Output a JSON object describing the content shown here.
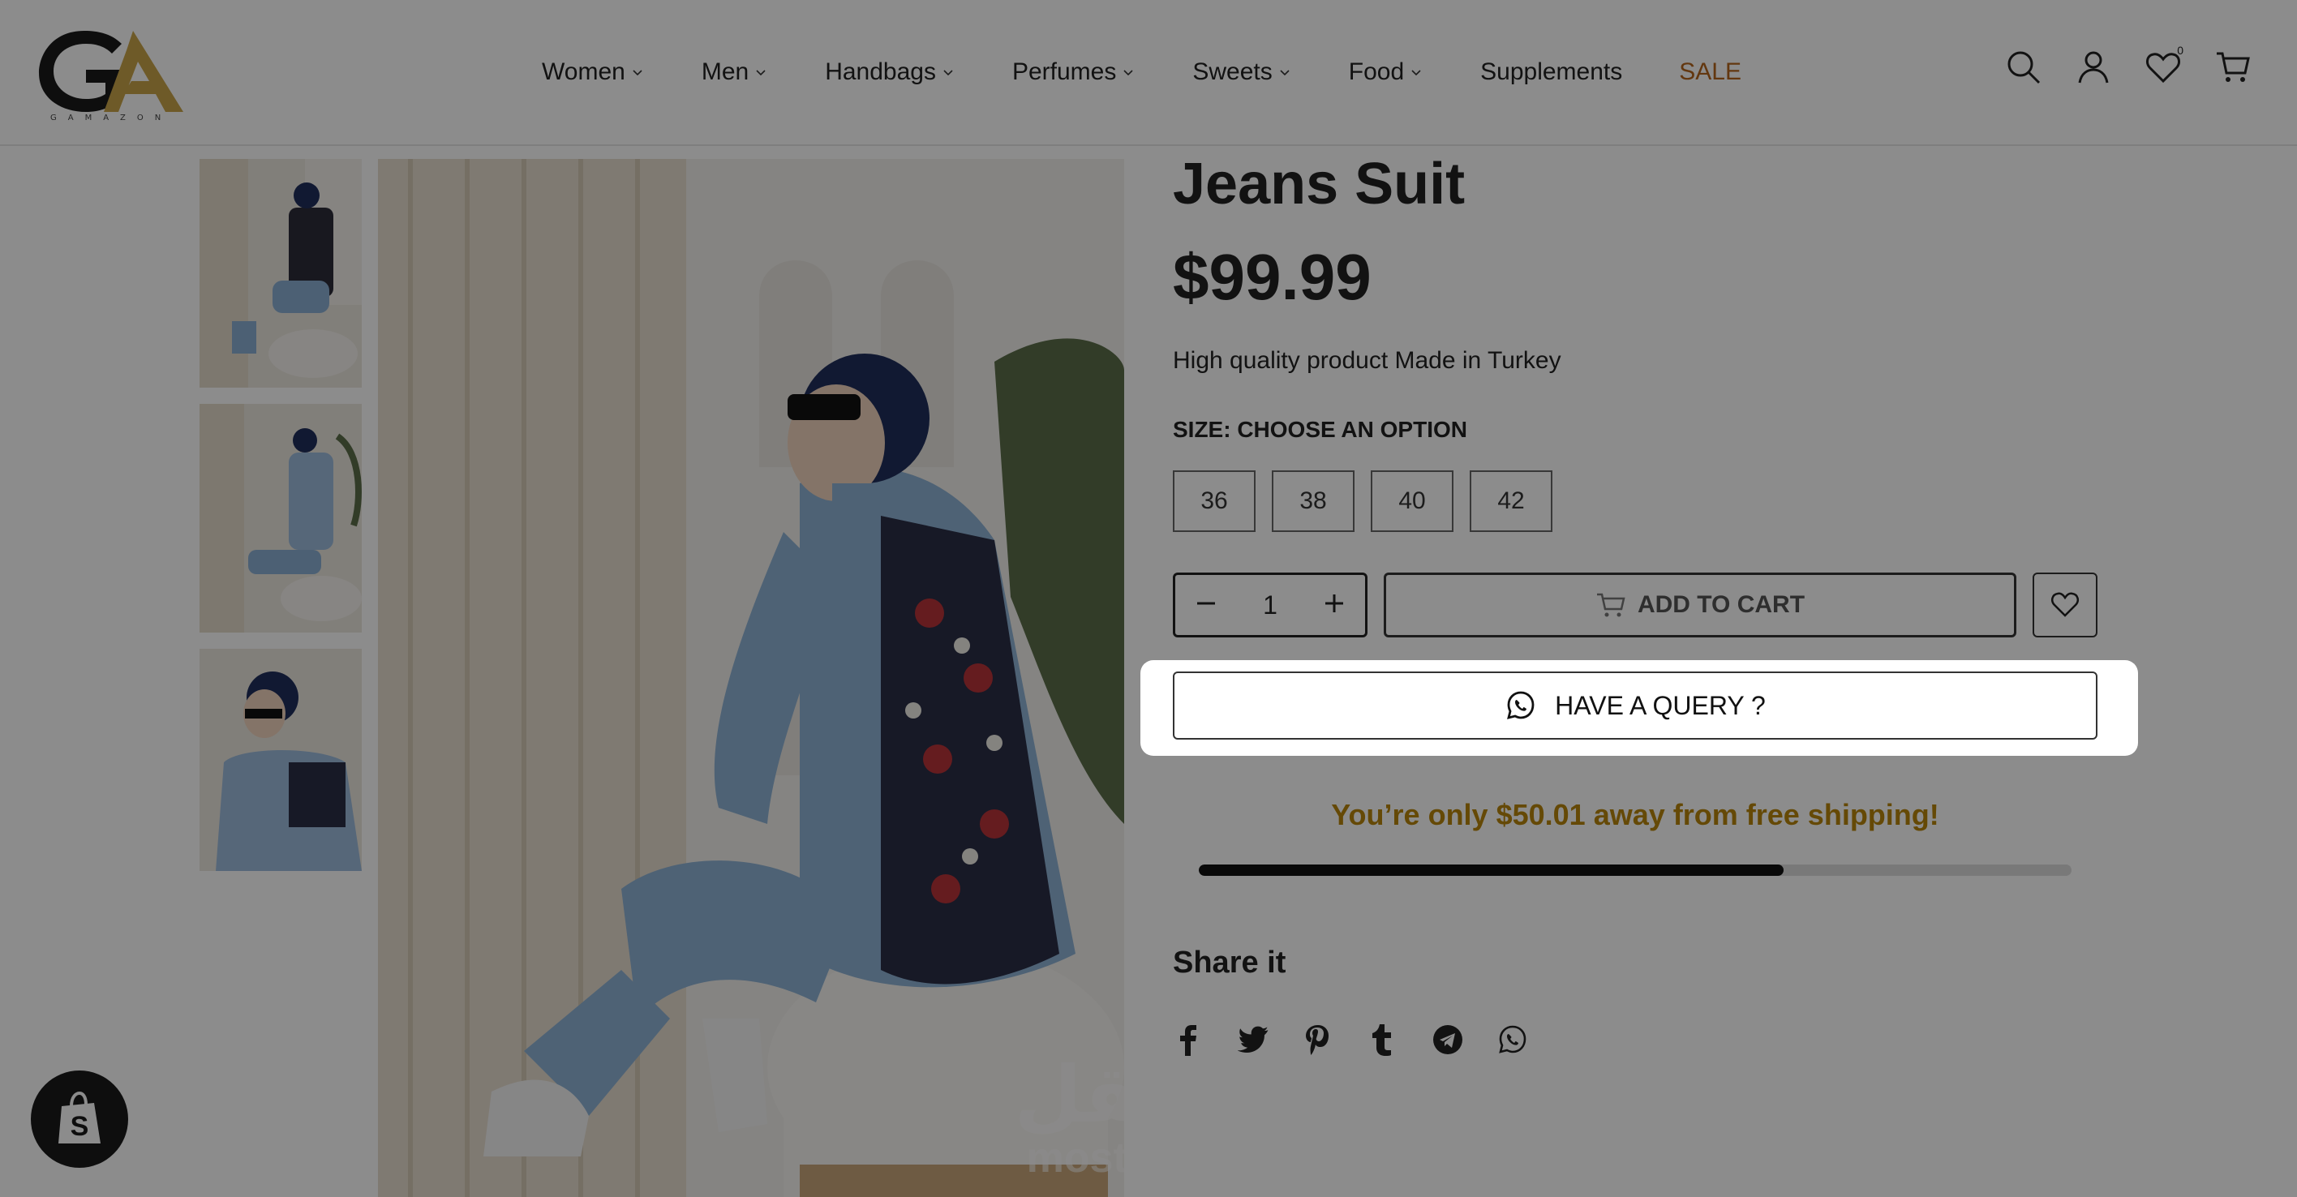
{
  "header": {
    "logo_text": "GA",
    "logo_sub": "GAMAZON",
    "nav": [
      {
        "label": "Women",
        "has_dropdown": true
      },
      {
        "label": "Men",
        "has_dropdown": true
      },
      {
        "label": "Handbags",
        "has_dropdown": true
      },
      {
        "label": "Perfumes",
        "has_dropdown": true
      },
      {
        "label": "Sweets",
        "has_dropdown": true
      },
      {
        "label": "Food",
        "has_dropdown": true
      },
      {
        "label": "Supplements",
        "has_dropdown": false
      },
      {
        "label": "SALE",
        "has_dropdown": false
      }
    ],
    "icons": [
      "search-icon",
      "account-icon",
      "wishlist-icon",
      "cart-icon"
    ],
    "wishlist_count": "0"
  },
  "product": {
    "title": "Jeans Suit",
    "price": "$99.99",
    "description": "High quality product Made in Turkey",
    "size_label": "SIZE: CHOOSE AN OPTION",
    "sizes": [
      "36",
      "38",
      "40",
      "42"
    ],
    "quantity": "1",
    "add_to_cart": "ADD TO CART",
    "query_label": "HAVE A QUERY ?",
    "shipping_message": "You’re only $50.01 away from free shipping!",
    "shipping_progress": 0.67,
    "share_title": "Share it",
    "share_icons": [
      "facebook-icon",
      "twitter-icon",
      "pinterest-icon",
      "tumblr-icon",
      "telegram-icon",
      "whatsapp-icon"
    ]
  },
  "watermark": {
    "arabic": "مستقل",
    "latin": "mostaql.com"
  },
  "colors": {
    "accent": "#b8860b",
    "sale": "#b5651d",
    "overlay": "rgba(0,0,0,0.45)"
  }
}
